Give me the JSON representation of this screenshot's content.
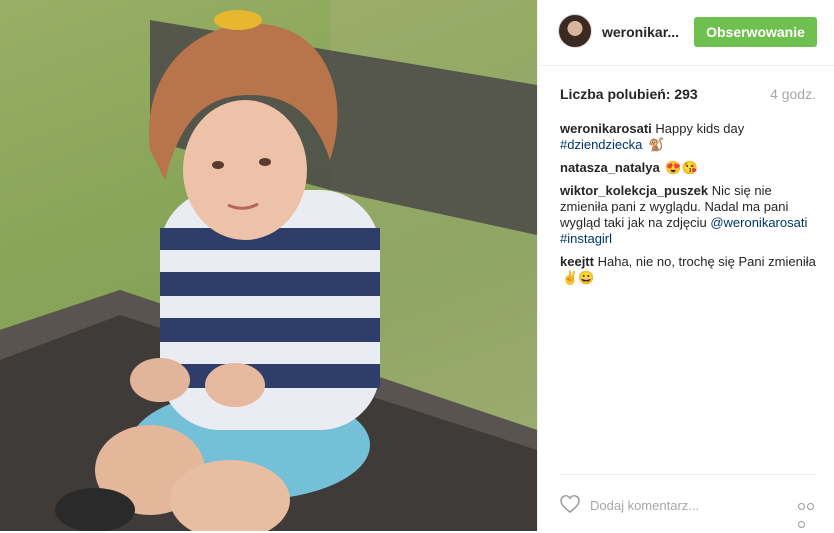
{
  "photo": {
    "alt_icon": "photo-of-child-on-bench"
  },
  "header": {
    "username": "weronikar...",
    "follow_label": "Obserwowanie",
    "follow_color": "#70c050"
  },
  "stats": {
    "likes_label": "Liczba polubień: 293",
    "time_label": "4 godz."
  },
  "comments": [
    {
      "user": "weronikarosati",
      "text": "Happy kids day",
      "tag": "#dziendziecka",
      "emoji": "🐒"
    },
    {
      "user": "natasza_natalya",
      "text": "",
      "emoji": "😍😘"
    },
    {
      "user": "wiktor_kolekcja_puszek",
      "text": "Nic się nie zmieniła pani z wyglądu. Nadal ma pani wygląd taki jak na zdjęciu",
      "mention": "@weronikarosati",
      "tag": "#instagirl"
    },
    {
      "user": "keejtt",
      "text": "Haha, nie no, trochę się Pani zmieniła",
      "emoji": "✌😀"
    }
  ],
  "footer": {
    "comment_placeholder": "Dodaj komentarz...",
    "like_icon": "heart-icon",
    "more_icon": "more-options-icon"
  }
}
